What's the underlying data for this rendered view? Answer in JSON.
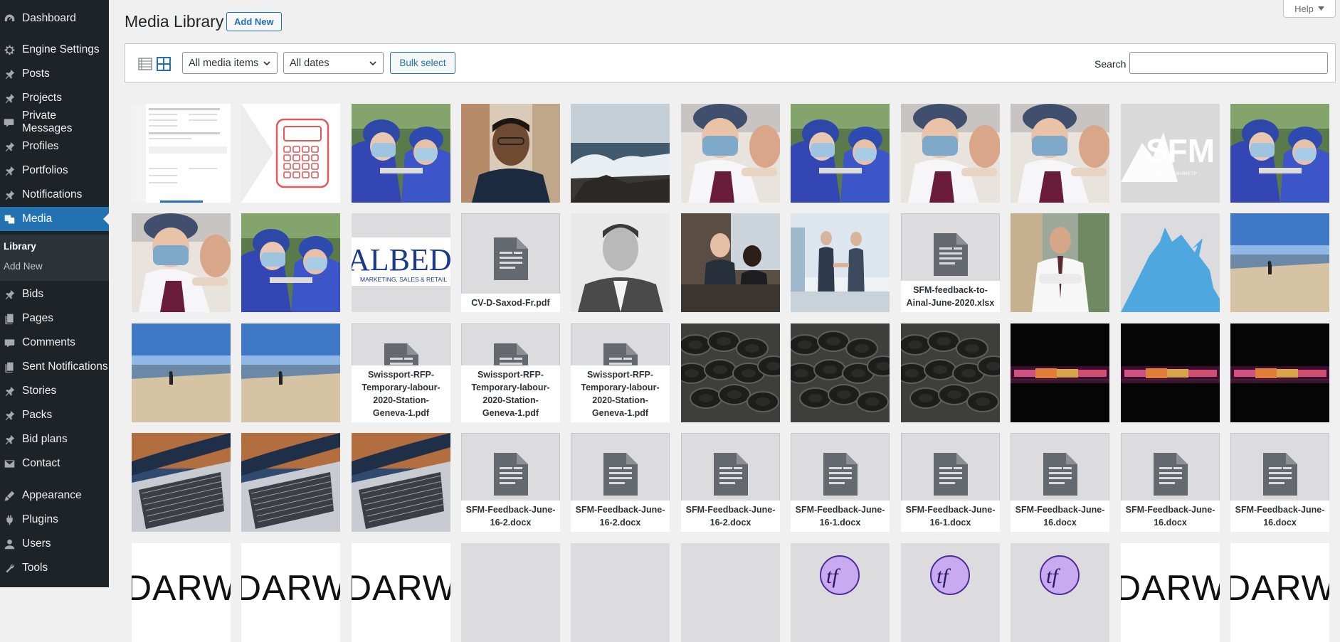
{
  "sidebar": {
    "items": [
      {
        "label": "Dashboard",
        "icon": "dashboard-icon"
      },
      {
        "label": "Engine Settings",
        "icon": "gear-icon"
      },
      {
        "label": "Posts",
        "icon": "pin-icon"
      },
      {
        "label": "Projects",
        "icon": "pin-icon"
      },
      {
        "label": "Private Messages",
        "icon": "comment-icon"
      },
      {
        "label": "Profiles",
        "icon": "pin-icon"
      },
      {
        "label": "Portfolios",
        "icon": "pin-icon"
      },
      {
        "label": "Notifications",
        "icon": "pin-icon"
      },
      {
        "label": "Media",
        "icon": "media-icon"
      },
      {
        "label": "Bids",
        "icon": "pin-icon"
      },
      {
        "label": "Pages",
        "icon": "pages-icon"
      },
      {
        "label": "Comments",
        "icon": "comment-icon"
      },
      {
        "label": "Sent Notifications",
        "icon": "pages-icon"
      },
      {
        "label": "Stories",
        "icon": "pin-icon"
      },
      {
        "label": "Packs",
        "icon": "pin-icon"
      },
      {
        "label": "Bid plans",
        "icon": "pin-icon"
      },
      {
        "label": "Contact",
        "icon": "mail-icon"
      },
      {
        "label": "Appearance",
        "icon": "brush-icon"
      },
      {
        "label": "Plugins",
        "icon": "plugin-icon"
      },
      {
        "label": "Users",
        "icon": "user-icon"
      },
      {
        "label": "Tools",
        "icon": "wrench-icon"
      }
    ],
    "submenu": {
      "library": "Library",
      "add_new": "Add New"
    }
  },
  "header": {
    "title": "Media Library",
    "add_new": "Add New",
    "help": "Help"
  },
  "toolbar": {
    "filter_type": "All media items",
    "filter_date": "All dates",
    "bulk_select": "Bulk select",
    "search_label": "Search",
    "search_value": ""
  },
  "colors": {
    "accent": "#2271b1",
    "sidebar_bg": "#1d2327",
    "page_bg": "#f0f0f1"
  },
  "media": [
    {
      "kind": "screenshot"
    },
    {
      "kind": "calculator"
    },
    {
      "kind": "dentist-two"
    },
    {
      "kind": "man-portrait"
    },
    {
      "kind": "ocean-waves"
    },
    {
      "kind": "dentist"
    },
    {
      "kind": "dentist-two"
    },
    {
      "kind": "dentist"
    },
    {
      "kind": "dentist"
    },
    {
      "kind": "sfm-logo",
      "text": "SFM"
    },
    {
      "kind": "dentist-two"
    },
    {
      "kind": "dentist"
    },
    {
      "kind": "dentist-two"
    },
    {
      "kind": "albed-logo",
      "text": "ALBED",
      "subtext": "MARKETING, SALES & RETAIL"
    },
    {
      "kind": "document",
      "name": "CV-D-Saxod-Fr.pdf"
    },
    {
      "kind": "bw-portrait"
    },
    {
      "kind": "office-meeting"
    },
    {
      "kind": "handshake"
    },
    {
      "kind": "document",
      "name": "SFM-feedback-to-Ainal-June-2020.xlsx"
    },
    {
      "kind": "business-man"
    },
    {
      "kind": "mountain-logo"
    },
    {
      "kind": "beach"
    },
    {
      "kind": "beach"
    },
    {
      "kind": "beach"
    },
    {
      "kind": "document",
      "name": "Swissport-RFP-Temporary-labour-2020-Station-Geneva-1.pdf"
    },
    {
      "kind": "document",
      "name": "Swissport-RFP-Temporary-labour-2020-Station-Geneva-1.pdf"
    },
    {
      "kind": "document",
      "name": "Swissport-RFP-Temporary-labour-2020-Station-Geneva-1.pdf"
    },
    {
      "kind": "tires"
    },
    {
      "kind": "tires"
    },
    {
      "kind": "tires"
    },
    {
      "kind": "neon-light"
    },
    {
      "kind": "neon-light"
    },
    {
      "kind": "neon-light"
    },
    {
      "kind": "laptop"
    },
    {
      "kind": "laptop"
    },
    {
      "kind": "laptop"
    },
    {
      "kind": "document",
      "name": "SFM-Feedback-June-16-2.docx"
    },
    {
      "kind": "document",
      "name": "SFM-Feedback-June-16-2.docx"
    },
    {
      "kind": "document",
      "name": "SFM-Feedback-June-16-2.docx"
    },
    {
      "kind": "document",
      "name": "SFM-Feedback-June-16-1.docx"
    },
    {
      "kind": "document",
      "name": "SFM-Feedback-June-16-1.docx"
    },
    {
      "kind": "document",
      "name": "SFM-Feedback-June-16.docx"
    },
    {
      "kind": "document",
      "name": "SFM-Feedback-June-16.docx"
    },
    {
      "kind": "document",
      "name": "SFM-Feedback-June-16.docx"
    },
    {
      "kind": "darwin-logo",
      "text": "DARWIN"
    },
    {
      "kind": "darwin-logo",
      "text": "DARWIN"
    },
    {
      "kind": "darwin-logo",
      "text": "DARWIN"
    },
    {
      "kind": "blank"
    },
    {
      "kind": "blank"
    },
    {
      "kind": "blank"
    },
    {
      "kind": "tf-logo",
      "text": "tf"
    },
    {
      "kind": "tf-logo",
      "text": "tf"
    },
    {
      "kind": "tf-logo",
      "text": "tf"
    },
    {
      "kind": "darwin-logo",
      "text": "DARWIN"
    },
    {
      "kind": "darwin-logo",
      "text": "DARWIN"
    }
  ]
}
